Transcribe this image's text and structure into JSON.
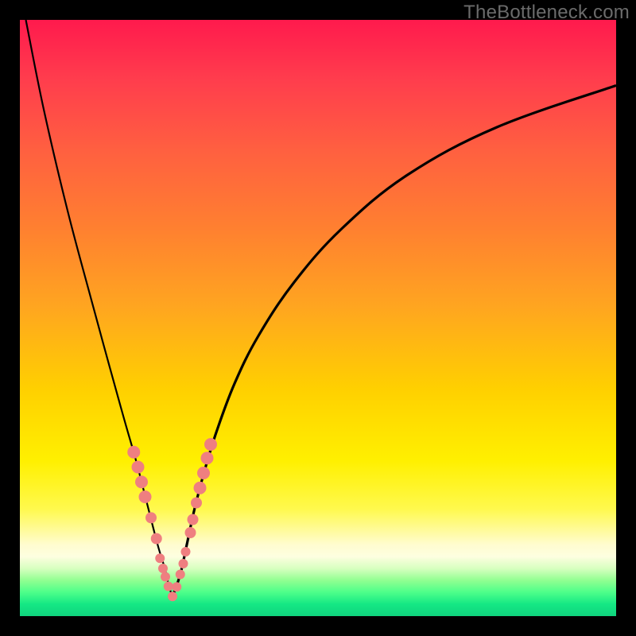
{
  "watermark": "TheBottleneck.com",
  "chart_data": {
    "type": "line",
    "title": "",
    "xlabel": "",
    "ylabel": "",
    "xlim": [
      0,
      100
    ],
    "ylim": [
      0,
      100
    ],
    "series": [
      {
        "name": "left-branch",
        "x": [
          1,
          4,
          8,
          12,
          15,
          17.5,
          19.5,
          21.3,
          23.1,
          24.3,
          25.0,
          25.6
        ],
        "y": [
          100,
          85,
          68,
          53,
          42,
          33,
          26,
          19,
          12,
          8,
          5,
          3.3
        ]
      },
      {
        "name": "right-branch",
        "x": [
          25.6,
          26.9,
          28,
          29.3,
          31,
          33,
          36,
          40,
          46,
          54,
          65,
          80,
          100
        ],
        "y": [
          3.3,
          7,
          12,
          18,
          24.5,
          31,
          39,
          47,
          56,
          65,
          74,
          82,
          89
        ]
      }
    ],
    "markers": {
      "name": "highlight-points",
      "color": "#ef7f80",
      "points": [
        {
          "x": 19.1,
          "y": 27.5,
          "r": 8
        },
        {
          "x": 19.8,
          "y": 25.0,
          "r": 8
        },
        {
          "x": 20.4,
          "y": 22.5,
          "r": 8
        },
        {
          "x": 21.0,
          "y": 20.0,
          "r": 8
        },
        {
          "x": 22.0,
          "y": 16.5,
          "r": 7
        },
        {
          "x": 22.9,
          "y": 13.0,
          "r": 7
        },
        {
          "x": 23.5,
          "y": 9.7,
          "r": 6
        },
        {
          "x": 24.0,
          "y": 8.0,
          "r": 6
        },
        {
          "x": 24.4,
          "y": 6.6,
          "r": 6
        },
        {
          "x": 24.9,
          "y": 5.0,
          "r": 6
        },
        {
          "x": 25.6,
          "y": 3.3,
          "r": 6
        },
        {
          "x": 26.3,
          "y": 4.9,
          "r": 6
        },
        {
          "x": 26.9,
          "y": 7.0,
          "r": 6
        },
        {
          "x": 27.4,
          "y": 8.8,
          "r": 6
        },
        {
          "x": 27.8,
          "y": 10.8,
          "r": 6
        },
        {
          "x": 28.6,
          "y": 14.0,
          "r": 7
        },
        {
          "x": 29.0,
          "y": 16.2,
          "r": 7
        },
        {
          "x": 29.6,
          "y": 19.0,
          "r": 7
        },
        {
          "x": 30.2,
          "y": 21.5,
          "r": 8
        },
        {
          "x": 30.8,
          "y": 24.0,
          "r": 8
        },
        {
          "x": 31.4,
          "y": 26.5,
          "r": 8
        },
        {
          "x": 32.0,
          "y": 28.8,
          "r": 8
        }
      ]
    },
    "gradient_stops": [
      {
        "pos": 0,
        "color": "#ff1a4d"
      },
      {
        "pos": 50,
        "color": "#ffa520"
      },
      {
        "pos": 80,
        "color": "#fff000"
      },
      {
        "pos": 100,
        "color": "#10d47e"
      }
    ]
  }
}
